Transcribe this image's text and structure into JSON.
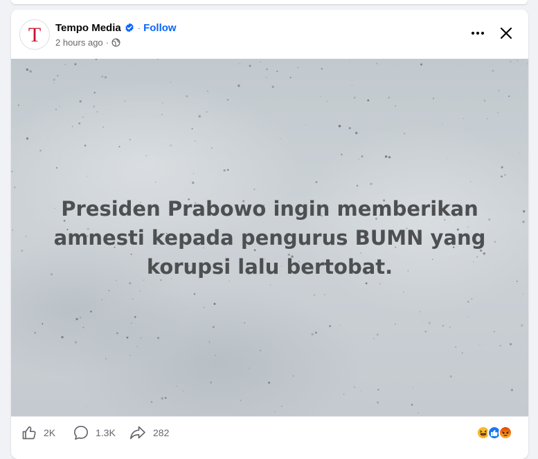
{
  "post": {
    "page_name": "Tempo Media",
    "avatar_letter": "T",
    "follow_label": "Follow",
    "time_ago": "2 hours ago",
    "separator": "·",
    "image_text_lines": [
      "Presiden Prabowo ingin memberikan",
      "amnesti kepada pengurus BUMN yang",
      "korupsi lalu bertobat."
    ]
  },
  "header_icons": {
    "verified": "verified-badge-icon",
    "audience": "globe-icon",
    "more": "more-options-icon",
    "close": "close-icon"
  },
  "actions": {
    "like_count": "2K",
    "comment_count": "1.3K",
    "share_count": "282"
  },
  "reactions": [
    "haha",
    "like",
    "angry"
  ],
  "colors": {
    "brand_blue": "#0866ff",
    "avatar_red": "#c8102e",
    "secondary_text": "#65676b",
    "image_text": "#4d4f51"
  }
}
